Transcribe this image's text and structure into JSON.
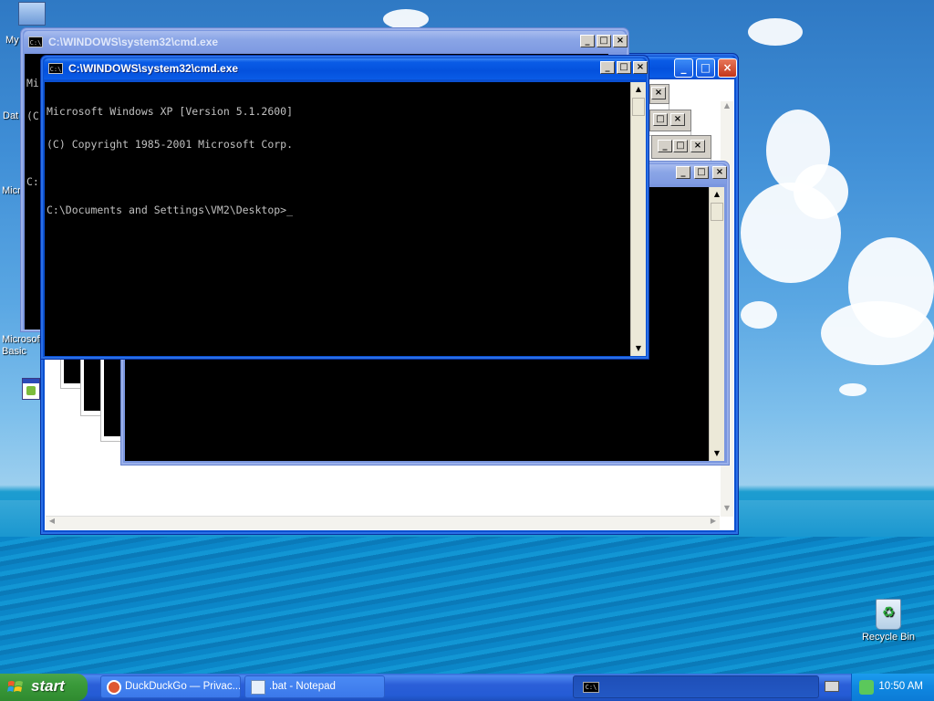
{
  "desktop": {
    "icons": [
      {
        "label": "My"
      },
      {
        "label": "Dat"
      },
      {
        "label": "Micro"
      },
      {
        "label": "Microsoft Basic"
      },
      {
        "label": "Recycle Bin"
      }
    ]
  },
  "windows": {
    "front_cmd": {
      "title": "C:\\WINDOWS\\system32\\cmd.exe",
      "lines": [
        "Microsoft Windows XP [Version 5.1.2600]",
        "(C) Copyright 1985-2001 Microsoft Corp.",
        "",
        "C:\\Documents and Settings\\VM2\\Desktop>_"
      ]
    },
    "back_cmd": {
      "title": "C:\\WINDOWS\\system32\\cmd.exe",
      "partial_lines": [
        "Mi",
        "(C",
        "",
        "C:"
      ]
    }
  },
  "caption_buttons": {
    "minimize": "_",
    "maximize": "□",
    "close": "×"
  },
  "taskbar": {
    "start_label": "start",
    "buttons": [
      {
        "label": "DuckDuckGo — Privac..."
      },
      {
        "label": ".bat - Notepad"
      },
      {
        "label": "C:\\"
      }
    ],
    "clock": "10:50 AM"
  },
  "colors": {
    "xp_blue": "#0a5ce6",
    "start_green": "#3a9a3a",
    "console_bg": "#000000",
    "console_fg": "#c0c0c0"
  }
}
